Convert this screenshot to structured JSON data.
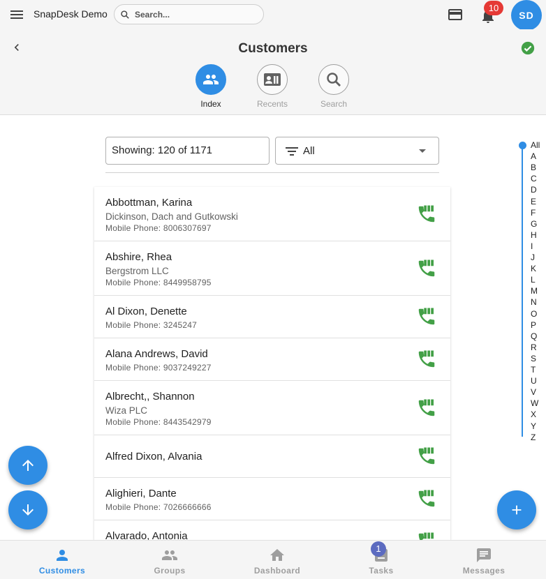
{
  "colors": {
    "accent": "#2f8de4",
    "call_green": "#43a047",
    "badge_red": "#e53935",
    "badge_indigo": "#5c6bc0"
  },
  "topbar": {
    "app_title": "SnapDesk Demo",
    "search_placeholder": "Search...",
    "notification_count": "10",
    "avatar_initials": "SD"
  },
  "header": {
    "title": "Customers",
    "tabs": [
      {
        "label": "Index",
        "icon": "people-icon",
        "active": true
      },
      {
        "label": "Recents",
        "icon": "contact-card-icon",
        "active": false
      },
      {
        "label": "Search",
        "icon": "search-icon",
        "active": false
      }
    ]
  },
  "filter": {
    "showing_text": "Showing: 120 of 1171",
    "selected": "All"
  },
  "customers": [
    {
      "name": "Abbottman, Karina",
      "company": "Dickinson, Dach and Gutkowski",
      "phone": "Mobile Phone: 8006307697"
    },
    {
      "name": "Abshire, Rhea",
      "company": "Bergstrom LLC",
      "phone": "Mobile Phone: 8449958795"
    },
    {
      "name": "Al Dixon, Denette",
      "company": "",
      "phone": "Mobile Phone: 3245247"
    },
    {
      "name": "Alana Andrews, David",
      "company": "",
      "phone": "Mobile Phone: 9037249227"
    },
    {
      "name": "Albrecht,, Shannon",
      "company": "Wiza PLC",
      "phone": "Mobile Phone: 8443542979"
    },
    {
      "name": "Alfred Dixon, Alvania",
      "company": "",
      "phone": ""
    },
    {
      "name": "Alighieri, Dante",
      "company": "",
      "phone": "Mobile Phone: 7026666666"
    },
    {
      "name": "Alvarado, Antonia",
      "company": "",
      "phone": ""
    }
  ],
  "alpha_index": [
    "All",
    "A",
    "B",
    "C",
    "D",
    "E",
    "F",
    "G",
    "H",
    "I",
    "J",
    "K",
    "L",
    "M",
    "N",
    "O",
    "P",
    "Q",
    "R",
    "S",
    "T",
    "U",
    "V",
    "W",
    "X",
    "Y",
    "Z"
  ],
  "bottom_nav": [
    {
      "label": "Customers",
      "icon": "person-icon",
      "active": true
    },
    {
      "label": "Groups",
      "icon": "groups-icon",
      "active": false
    },
    {
      "label": "Dashboard",
      "icon": "home-icon",
      "active": false
    },
    {
      "label": "Tasks",
      "icon": "tasks-icon",
      "active": false,
      "badge": "1"
    },
    {
      "label": "Messages",
      "icon": "message-icon",
      "active": false
    }
  ]
}
